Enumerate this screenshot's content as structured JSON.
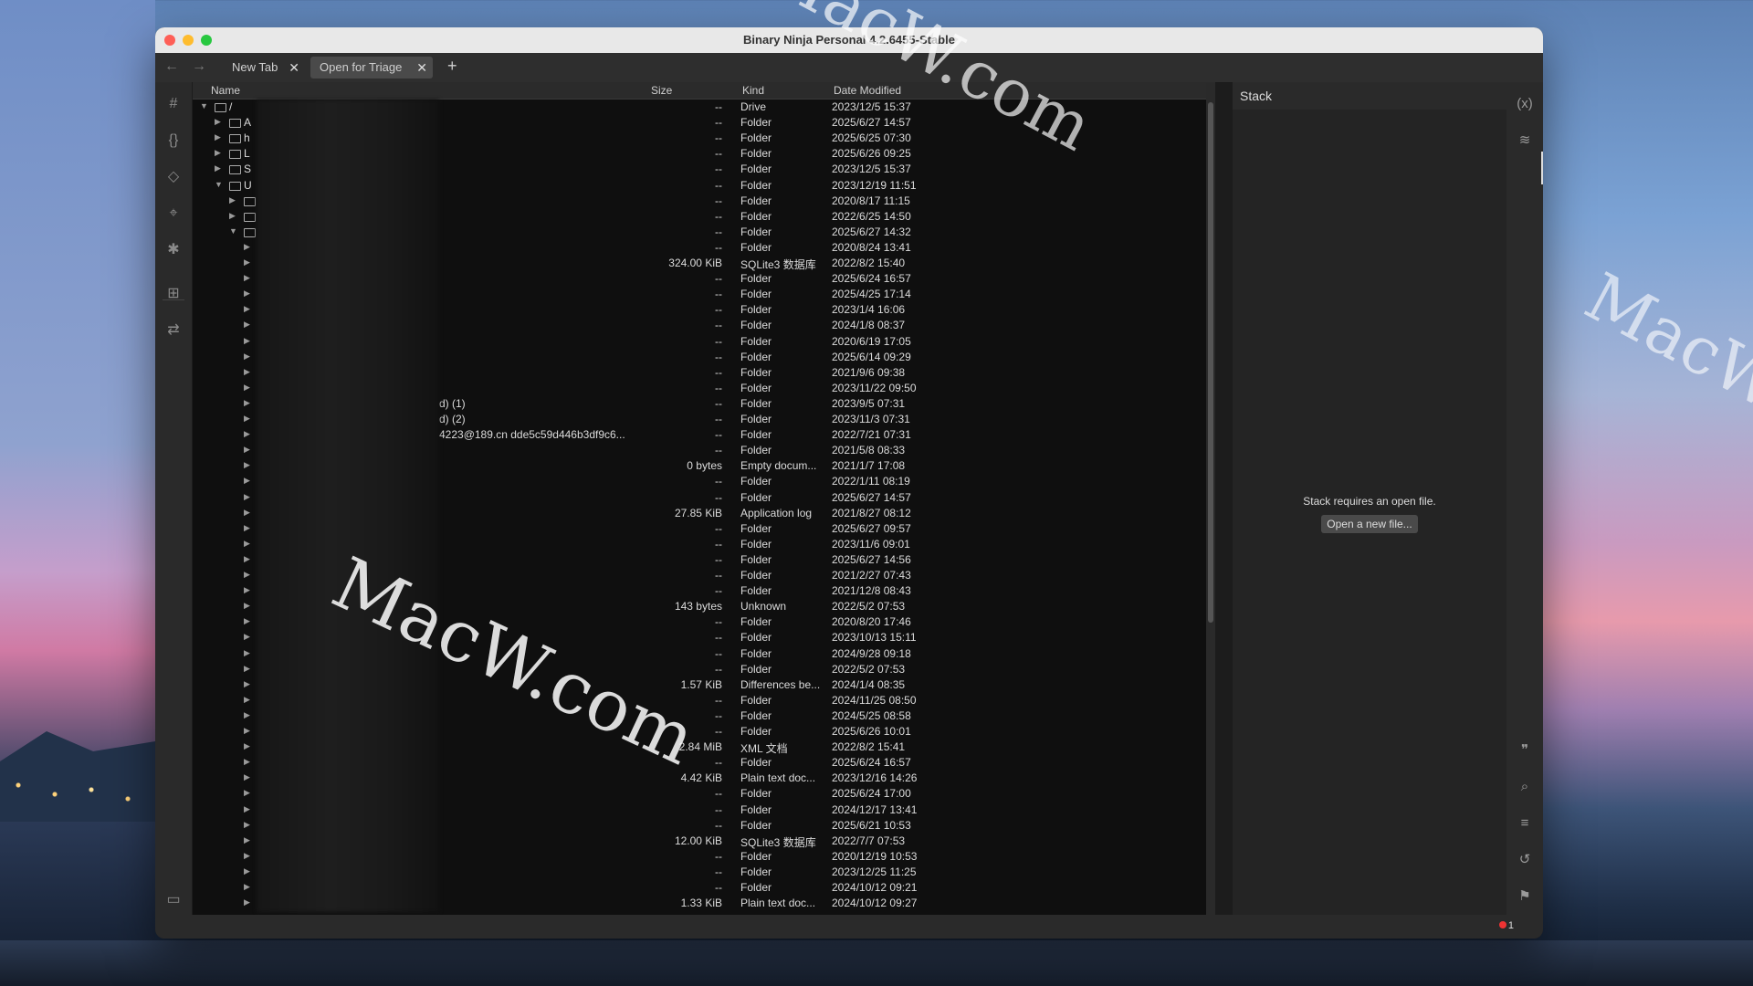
{
  "window": {
    "title": "Binary Ninja Personal 4.2.6455-Stable"
  },
  "tabs": [
    {
      "label": "New Tab"
    },
    {
      "label": "Open for Triage"
    }
  ],
  "columns": {
    "name": "Name",
    "size": "Size",
    "kind": "Kind",
    "date": "Date Modified"
  },
  "rows": [
    {
      "name": "/",
      "size": "--",
      "kind": "Drive",
      "date": "2023/12/5 15:37"
    },
    {
      "name": "A",
      "size": "--",
      "kind": "Folder",
      "date": "2025/6/27 14:57"
    },
    {
      "name": "h",
      "size": "--",
      "kind": "Folder",
      "date": "2025/6/25 07:30"
    },
    {
      "name": "L",
      "size": "--",
      "kind": "Folder",
      "date": "2025/6/26 09:25"
    },
    {
      "name": "S",
      "size": "--",
      "kind": "Folder",
      "date": "2023/12/5 15:37"
    },
    {
      "name": "U",
      "size": "--",
      "kind": "Folder",
      "date": "2023/12/19 11:51"
    },
    {
      "name": "",
      "size": "--",
      "kind": "Folder",
      "date": "2020/8/17 11:15"
    },
    {
      "name": "",
      "size": "--",
      "kind": "Folder",
      "date": "2022/6/25 14:50"
    },
    {
      "name": "",
      "size": "--",
      "kind": "Folder",
      "date": "2025/6/27 14:32"
    },
    {
      "name": "",
      "size": "--",
      "kind": "Folder",
      "date": "2020/8/24 13:41"
    },
    {
      "name": "",
      "size": "324.00 KiB",
      "kind": "SQLite3 数据库",
      "date": "2022/8/2 15:40"
    },
    {
      "name": "",
      "size": "--",
      "kind": "Folder",
      "date": "2025/6/24 16:57"
    },
    {
      "name": "",
      "size": "--",
      "kind": "Folder",
      "date": "2025/4/25 17:14"
    },
    {
      "name": "",
      "size": "--",
      "kind": "Folder",
      "date": "2023/1/4 16:06"
    },
    {
      "name": "",
      "size": "--",
      "kind": "Folder",
      "date": "2024/1/8 08:37"
    },
    {
      "name": "",
      "size": "--",
      "kind": "Folder",
      "date": "2020/6/19 17:05"
    },
    {
      "name": "",
      "size": "--",
      "kind": "Folder",
      "date": "2025/6/14 09:29"
    },
    {
      "name": "",
      "size": "--",
      "kind": "Folder",
      "date": "2021/9/6 09:38"
    },
    {
      "name": "",
      "size": "--",
      "kind": "Folder",
      "date": "2023/11/22 09:50"
    },
    {
      "name": "d) (1)",
      "size": "--",
      "kind": "Folder",
      "date": "2023/9/5 07:31"
    },
    {
      "name": "d) (2)",
      "size": "--",
      "kind": "Folder",
      "date": "2023/11/3 07:31"
    },
    {
      "name": "4223@189.cn dde5c59d446b3df9c6...",
      "size": "--",
      "kind": "Folder",
      "date": "2022/7/21 07:31"
    },
    {
      "name": "",
      "size": "--",
      "kind": "Folder",
      "date": "2021/5/8 08:33"
    },
    {
      "name": "",
      "size": "0 bytes",
      "kind": "Empty docum...",
      "date": "2021/1/7 17:08"
    },
    {
      "name": "",
      "size": "--",
      "kind": "Folder",
      "date": "2022/1/11 08:19"
    },
    {
      "name": "",
      "size": "--",
      "kind": "Folder",
      "date": "2025/6/27 14:57"
    },
    {
      "name": "",
      "size": "27.85 KiB",
      "kind": "Application log",
      "date": "2021/8/27 08:12"
    },
    {
      "name": "",
      "size": "--",
      "kind": "Folder",
      "date": "2025/6/27 09:57"
    },
    {
      "name": "",
      "size": "--",
      "kind": "Folder",
      "date": "2023/11/6 09:01"
    },
    {
      "name": "",
      "size": "--",
      "kind": "Folder",
      "date": "2025/6/27 14:56"
    },
    {
      "name": "",
      "size": "--",
      "kind": "Folder",
      "date": "2021/2/27 07:43"
    },
    {
      "name": "",
      "size": "--",
      "kind": "Folder",
      "date": "2021/12/8 08:43"
    },
    {
      "name": "",
      "size": "143 bytes",
      "kind": "Unknown",
      "date": "2022/5/2 07:53"
    },
    {
      "name": "",
      "size": "--",
      "kind": "Folder",
      "date": "2020/8/20 17:46"
    },
    {
      "name": "",
      "size": "--",
      "kind": "Folder",
      "date": "2023/10/13 15:11"
    },
    {
      "name": "",
      "size": "--",
      "kind": "Folder",
      "date": "2024/9/28 09:18"
    },
    {
      "name": "",
      "size": "--",
      "kind": "Folder",
      "date": "2022/5/2 07:53"
    },
    {
      "name": "",
      "size": "1.57 KiB",
      "kind": "Differences be...",
      "date": "2024/1/4 08:35"
    },
    {
      "name": "",
      "size": "--",
      "kind": "Folder",
      "date": "2024/11/25 08:50"
    },
    {
      "name": "",
      "size": "--",
      "kind": "Folder",
      "date": "2024/5/25 08:58"
    },
    {
      "name": "",
      "size": "--",
      "kind": "Folder",
      "date": "2025/6/26 10:01"
    },
    {
      "name": "",
      "size": "2.84 MiB",
      "kind": "XML 文档",
      "date": "2022/8/2 15:41"
    },
    {
      "name": "",
      "size": "--",
      "kind": "Folder",
      "date": "2025/6/24 16:57"
    },
    {
      "name": "",
      "size": "4.42 KiB",
      "kind": "Plain text doc...",
      "date": "2023/12/16 14:26"
    },
    {
      "name": "",
      "size": "--",
      "kind": "Folder",
      "date": "2025/6/24 17:00"
    },
    {
      "name": "",
      "size": "--",
      "kind": "Folder",
      "date": "2024/12/17 13:41"
    },
    {
      "name": "",
      "size": "--",
      "kind": "Folder",
      "date": "2025/6/21 10:53"
    },
    {
      "name": "",
      "size": "12.00 KiB",
      "kind": "SQLite3 数据库",
      "date": "2022/7/7 07:53"
    },
    {
      "name": "",
      "size": "--",
      "kind": "Folder",
      "date": "2020/12/19 10:53"
    },
    {
      "name": "",
      "size": "--",
      "kind": "Folder",
      "date": "2023/12/25 11:25"
    },
    {
      "name": "",
      "size": "--",
      "kind": "Folder",
      "date": "2024/10/12 09:21"
    },
    {
      "name": "",
      "size": "1.33 KiB",
      "kind": "Plain text doc...",
      "date": "2024/10/12 09:27"
    }
  ],
  "stack": {
    "title": "Stack",
    "message": "Stack requires an open file.",
    "button": "Open a new file..."
  },
  "status": {
    "error_count": "1"
  },
  "watermark": "MacW.com",
  "icons": {
    "left_sidebar": [
      "hash-icon",
      "braces-icon",
      "tag-icon",
      "location-pin-icon",
      "bug-icon",
      "hierarchy-icon",
      "compare-icon"
    ],
    "right_sidebar": [
      "variable-icon",
      "layers-icon",
      "quote-icon",
      "search-icon",
      "text-lines-icon",
      "history-icon",
      "flag-icon"
    ]
  }
}
